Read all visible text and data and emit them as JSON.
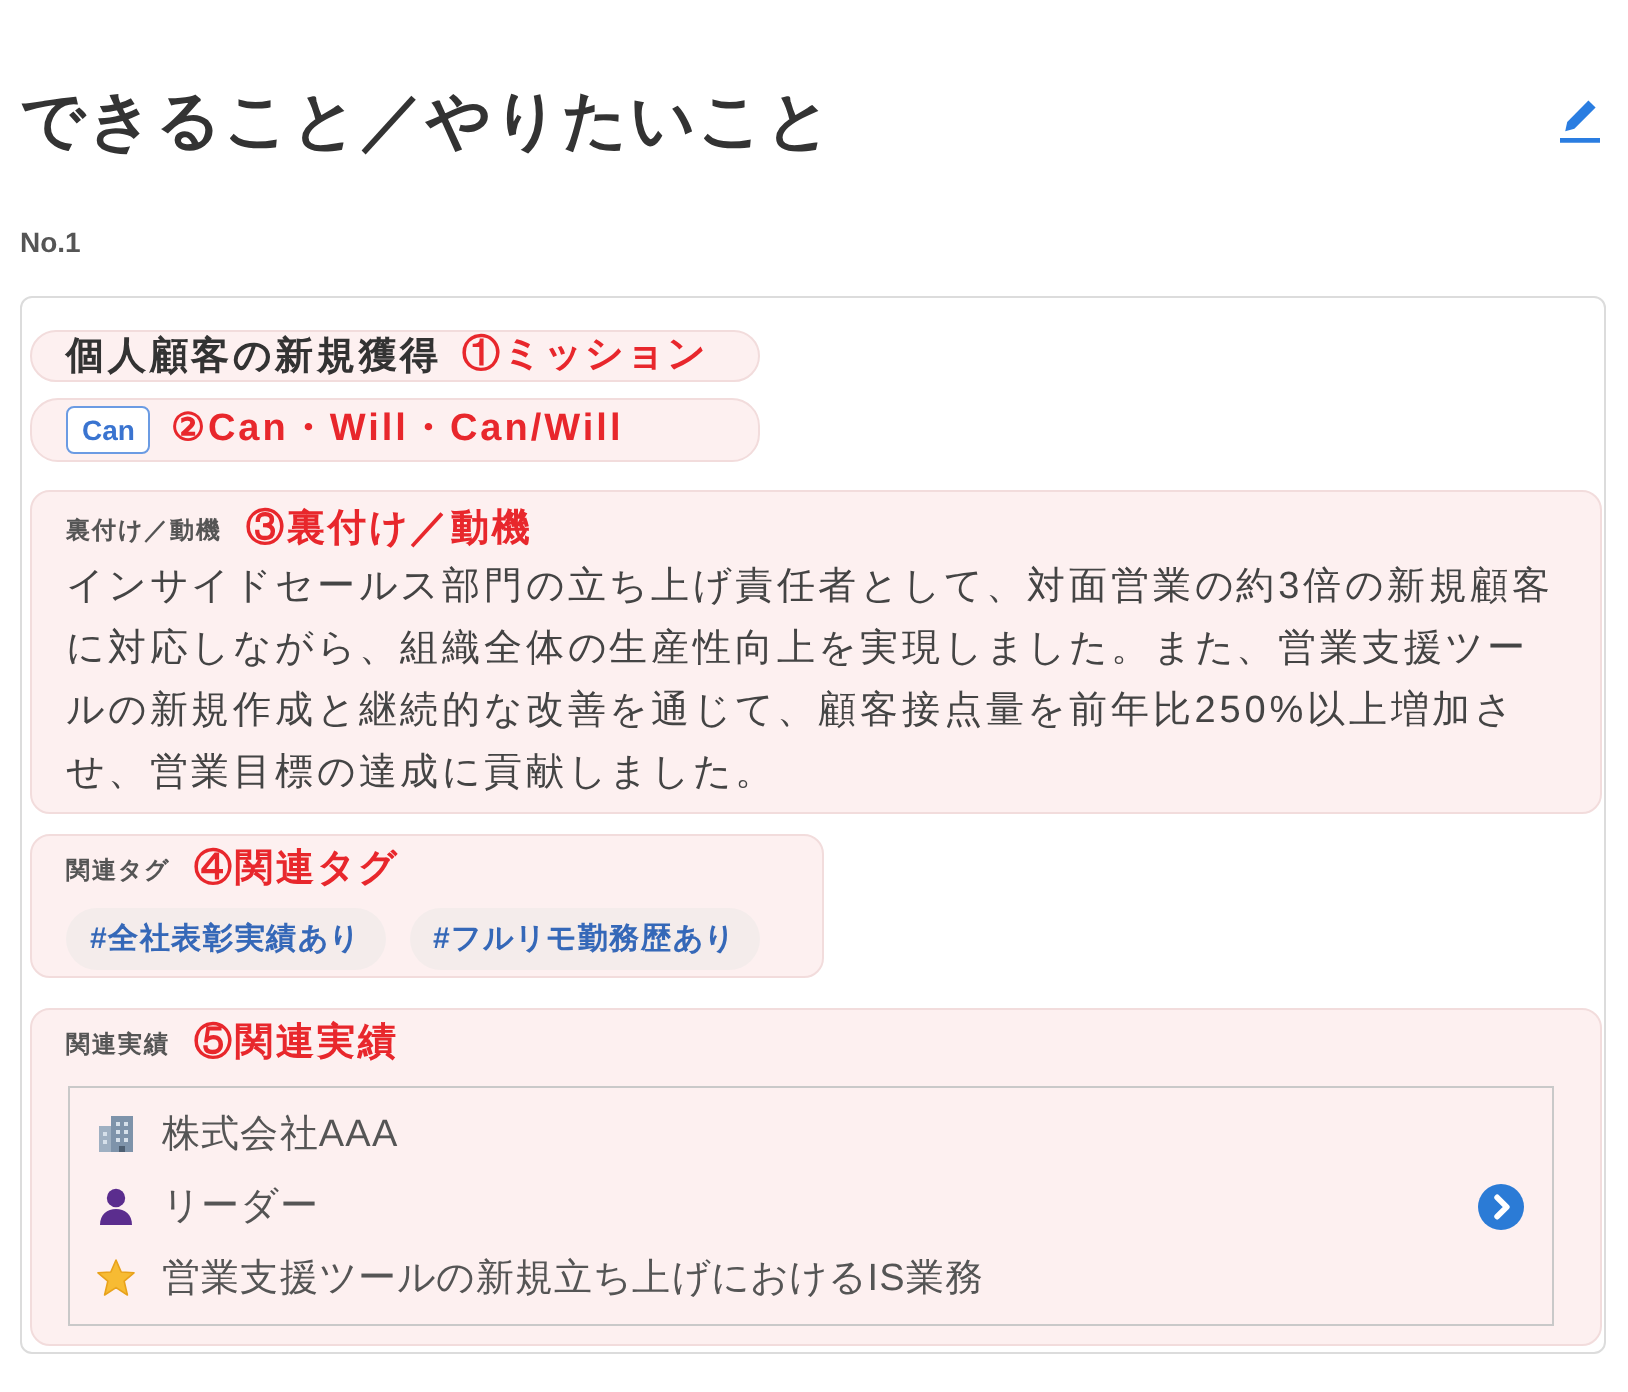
{
  "header": {
    "title": "できること／やりたいこと"
  },
  "entry": {
    "number": "No.1",
    "mission": {
      "text": "個人顧客の新規獲得",
      "annotation": "①ミッション"
    },
    "type": {
      "badge": "Can",
      "annotation": "②Can・Will・Can/Will"
    },
    "motivation": {
      "label": "裏付け／動機",
      "annotation": "③裏付け／動機",
      "text": "インサイドセールス部門の立ち上げ責任者として、対面営業の約3倍の新規顧客に対応しながら、組織全体の生産性向上を実現しました。また、営業支援ツールの新規作成と継続的な改善を通じて、顧客接点量を前年比250%以上増加させ、営業目標の達成に貢献しました。"
    },
    "tags": {
      "label": "関連タグ",
      "annotation": "④関連タグ",
      "items": [
        "#全社表彰実績あり",
        "#フルリモ勤務歴あり"
      ]
    },
    "achievements": {
      "label": "関連実績",
      "annotation": "⑤関連実績",
      "rows": [
        {
          "kind": "company",
          "text": "株式会社AAA"
        },
        {
          "kind": "role",
          "text": "リーダー"
        },
        {
          "kind": "project",
          "text": "営業支援ツールの新規立ち上げにおけるIS業務"
        }
      ]
    }
  }
}
